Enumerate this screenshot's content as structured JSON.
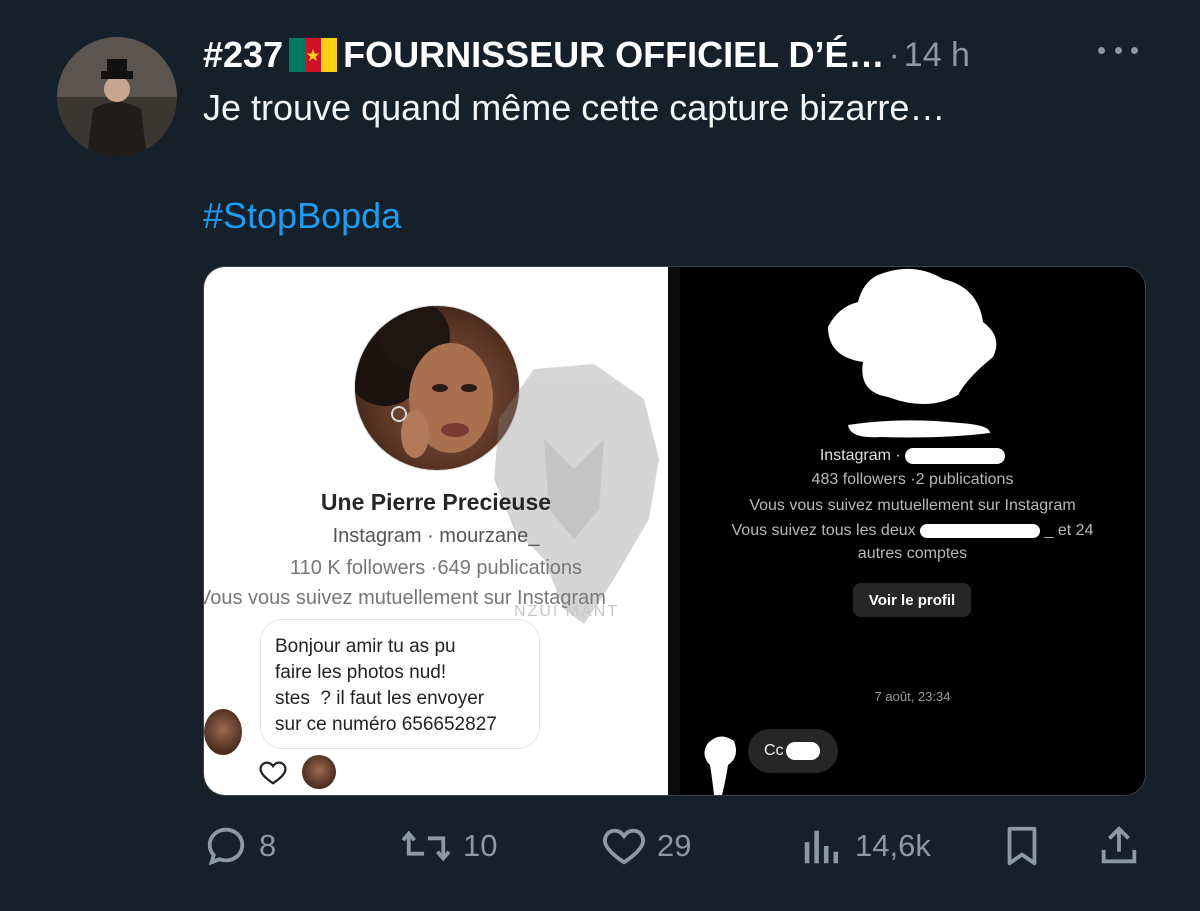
{
  "tweet": {
    "author_name": "#237",
    "author_name_rest": "FOURNISSEUR OFFICIEL D’É…",
    "separator": "·",
    "time": "14 h",
    "text": "Je trouve quand même cette capture bizarre…",
    "hashtag": "#StopBopda"
  },
  "left_screenshot": {
    "profile_name": "Une Pierre Precieuse",
    "instagram_line": "Instagram · mourzane_",
    "stats_line": "110 K followers ·649 publications",
    "mutual_line": "Vous vous suivez mutuellement sur Instagram",
    "watermark_text": "NZUI MANT",
    "message": "Bonjour amir tu as pu\nfaire les photos nud!\nstes  ? il faut les envoyer\nsur ce numéro 656652827"
  },
  "right_screenshot": {
    "instagram_line": "Instagram ·",
    "stats_line": "483 followers ·2 publications",
    "mutual_line": "Vous vous suivez mutuellement sur Instagram",
    "both_follow_line_start": "Vous suivez tous les deux",
    "both_follow_line_end": "_ et 24",
    "others_line": "autres comptes",
    "view_profile_button": "Voir le profil",
    "date": "7 août, 23:34",
    "message": "Cc"
  },
  "actions": {
    "replies": "8",
    "retweets": "10",
    "likes": "29",
    "views": "14,6k"
  },
  "colors": {
    "background": "#15202b",
    "link": "#1d9bf0",
    "muted": "#8b98a5"
  }
}
